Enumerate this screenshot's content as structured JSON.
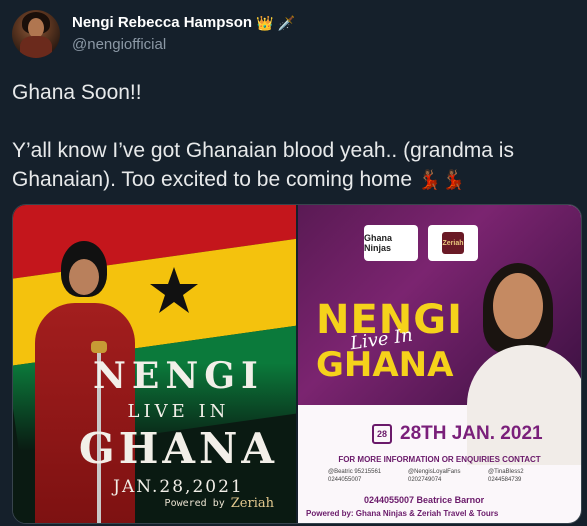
{
  "author": {
    "display_name": "Nengi Rebecca Hampson",
    "handle": "@nengiofficial",
    "badges": [
      "👑",
      "🗡️"
    ]
  },
  "tweet": {
    "line1": "Ghana Soon!!",
    "line2": "Y’all know I’ve got Ghanaian blood yeah.. (grandma is Ghanaian). Too excited to be coming home",
    "trailing_emoji": "💃🏾💃🏾"
  },
  "media": {
    "left": {
      "title_nengi": "NENGI",
      "title_live_in": "LIVE IN",
      "title_ghana": "GHANA",
      "date": "JAN.28,2021",
      "powered_by": "Powered by",
      "brand": "Zeriah"
    },
    "right": {
      "logo_ninjas": "Ghana Ninjas",
      "logo_zeriah": "Zeriah",
      "headline_nengi": "NENGI",
      "headline_live_in": "Live In",
      "headline_ghana": "GHANA",
      "calendar_day": "28",
      "date": "28TH JAN. 2021",
      "info_heading": "FOR MORE INFORMATION OR ENQUIRIES CONTACT",
      "contacts": [
        "@Beatric 95215561",
        "@NengisLoyalFans",
        "@TinaBless2",
        "0244055007",
        "0202749074",
        "0244584739"
      ],
      "phone_line": "0244055007 Beatrice Barnor",
      "powered_line": "Powered by:   Ghana Ninjas & Zeriah Travel & Tours"
    }
  },
  "colors": {
    "background": "#15202b",
    "flag_red": "#c4161c",
    "flag_gold": "#f4c20d",
    "flag_green": "#0b7a3b",
    "accent_yellow": "#f5d21b",
    "accent_purple": "#7a1f7a"
  }
}
